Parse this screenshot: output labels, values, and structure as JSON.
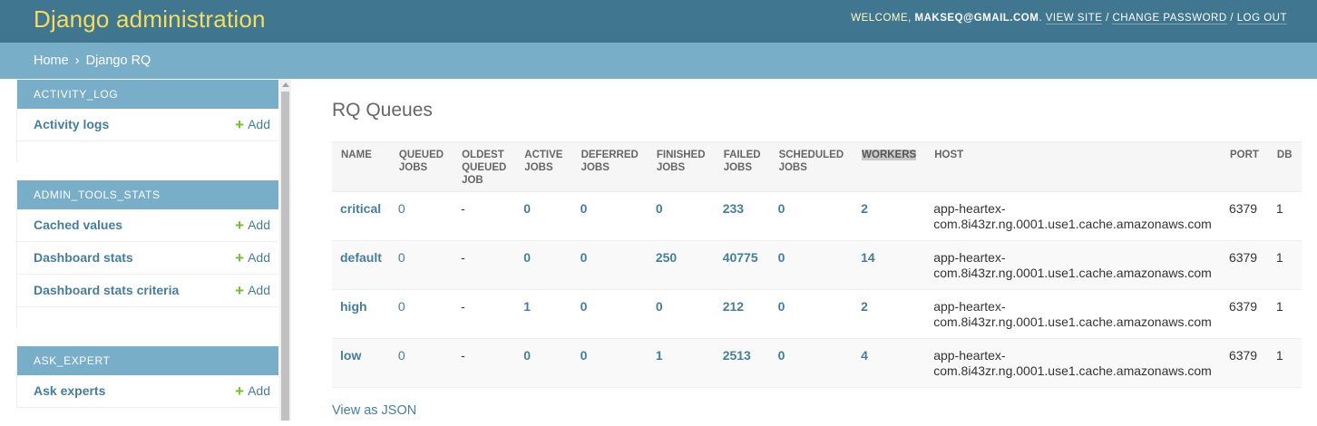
{
  "header": {
    "brand": "Django administration",
    "welcome": "WELCOME, ",
    "username": "MAKSEQ@GMAIL.COM",
    "period": ".",
    "view_site": "VIEW SITE",
    "sep": "/",
    "change_password": "CHANGE PASSWORD",
    "log_out": "LOG OUT"
  },
  "breadcrumbs": {
    "home": "Home",
    "separator": "›",
    "current": "Django RQ"
  },
  "sidebar": {
    "add_label": "Add",
    "modules": [
      {
        "caption": "ACTIVITY_LOG",
        "models": [
          {
            "name": "Activity logs"
          }
        ]
      },
      {
        "caption": "ADMIN_TOOLS_STATS",
        "models": [
          {
            "name": "Cached values"
          },
          {
            "name": "Dashboard stats"
          },
          {
            "name": "Dashboard stats criteria"
          }
        ]
      },
      {
        "caption": "ASK_EXPERT",
        "models": [
          {
            "name": "Ask experts"
          }
        ]
      }
    ]
  },
  "main": {
    "title": "RQ Queues",
    "columns": {
      "name": "NAME",
      "queued": [
        "QUEUED",
        "JOBS"
      ],
      "oldest": [
        "OLDEST",
        "QUEUED",
        "JOB"
      ],
      "active": [
        "ACTIVE",
        "JOBS"
      ],
      "deferred": [
        "DEFERRED",
        "JOBS"
      ],
      "finished": [
        "FINISHED",
        "JOBS"
      ],
      "failed": [
        "FAILED",
        "JOBS"
      ],
      "scheduled": [
        "SCHEDULED",
        "JOBS"
      ],
      "workers": "WORKERS",
      "host": "HOST",
      "port": "PORT",
      "db": "DB"
    },
    "rows": [
      {
        "name": "critical",
        "queued": "0",
        "oldest": "-",
        "active": "0",
        "deferred": "0",
        "finished": "0",
        "failed": "233",
        "scheduled": "0",
        "workers": "2",
        "host1": "app-heartex-",
        "host2": "com.8i43zr.ng.0001.use1.cache.amazonaws.com",
        "port": "6379",
        "db": "1"
      },
      {
        "name": "default",
        "queued": "0",
        "oldest": "-",
        "active": "0",
        "deferred": "0",
        "finished": "250",
        "failed": "40775",
        "scheduled": "0",
        "workers": "14",
        "host1": "app-heartex-",
        "host2": "com.8i43zr.ng.0001.use1.cache.amazonaws.com",
        "port": "6379",
        "db": "1"
      },
      {
        "name": "high",
        "queued": "0",
        "oldest": "-",
        "active": "1",
        "deferred": "0",
        "finished": "0",
        "failed": "212",
        "scheduled": "0",
        "workers": "2",
        "host1": "app-heartex-",
        "host2": "com.8i43zr.ng.0001.use1.cache.amazonaws.com",
        "port": "6379",
        "db": "1"
      },
      {
        "name": "low",
        "queued": "0",
        "oldest": "-",
        "active": "0",
        "deferred": "0",
        "finished": "1",
        "failed": "2513",
        "scheduled": "0",
        "workers": "4",
        "host1": "app-heartex-",
        "host2": "com.8i43zr.ng.0001.use1.cache.amazonaws.com",
        "port": "6379",
        "db": "1"
      }
    ],
    "json_link": "View as JSON"
  },
  "colors": {
    "header": "#417690",
    "brand": "#f5dd5d",
    "breadcrumbs": "#79aec8",
    "link": "#447e9b",
    "add_plus": "#70bf2b"
  },
  "icons": {
    "add": "plus-icon"
  }
}
